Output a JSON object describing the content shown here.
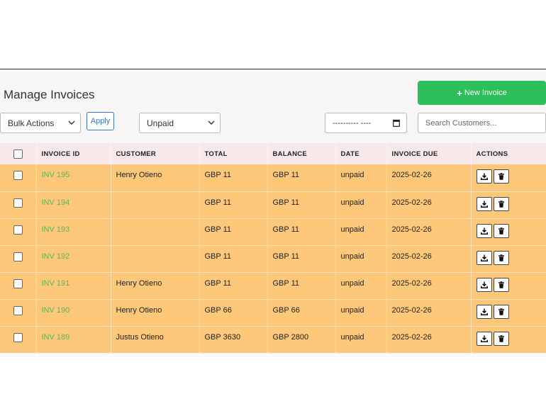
{
  "header": {
    "title": "Manage Invoices",
    "new_invoice_label": "New Invoice"
  },
  "toolbar": {
    "bulk_actions": "Bulk Actions",
    "apply_label": "Apply",
    "status_filter": "Unpaid",
    "date_placeholder": "---------- ----",
    "search_placeholder": "Search Customers..."
  },
  "table": {
    "columns": [
      "INVOICE ID",
      "CUSTOMER",
      "TOTAL",
      "BALANCE",
      "DATE",
      "INVOICE DUE",
      "ACTIONS"
    ],
    "rows": [
      {
        "id": "INV 195",
        "customer": "Henry Otieno",
        "total": "GBP 11",
        "balance": "GBP 11",
        "date": "unpaid",
        "due": "2025-02-26"
      },
      {
        "id": "INV 194",
        "customer": "",
        "total": "GBP 11",
        "balance": "GBP 11",
        "date": "unpaid",
        "due": "2025-02-26"
      },
      {
        "id": "INV 193",
        "customer": "",
        "total": "GBP 11",
        "balance": "GBP 11",
        "date": "unpaid",
        "due": "2025-02-26"
      },
      {
        "id": "INV 192",
        "customer": "",
        "total": "GBP 11",
        "balance": "GBP 11",
        "date": "unpaid",
        "due": "2025-02-26"
      },
      {
        "id": "INV 191",
        "customer": "Henry Otieno",
        "total": "GBP 11",
        "balance": "GBP 11",
        "date": "unpaid",
        "due": "2025-02-26"
      },
      {
        "id": "INV 190",
        "customer": "Henry Otieno",
        "total": "GBP 66",
        "balance": "GBP 66",
        "date": "unpaid",
        "due": "2025-02-26"
      },
      {
        "id": "INV 189",
        "customer": "Justus Otieno",
        "total": "GBP 3630",
        "balance": "GBP 2800",
        "date": "unpaid",
        "due": "2025-02-26"
      }
    ]
  },
  "colors": {
    "accent_green": "#2cbf5b",
    "row_highlight": "#fdc87a",
    "header_row": "#f7e9e9",
    "link_green": "#54b85a",
    "apply_blue": "#3a78c2"
  },
  "icons": {
    "new_invoice": "plus-icon",
    "download": "download-icon",
    "delete": "trash-icon",
    "dropdown": "chevron-down-icon",
    "date": "calendar-icon"
  }
}
